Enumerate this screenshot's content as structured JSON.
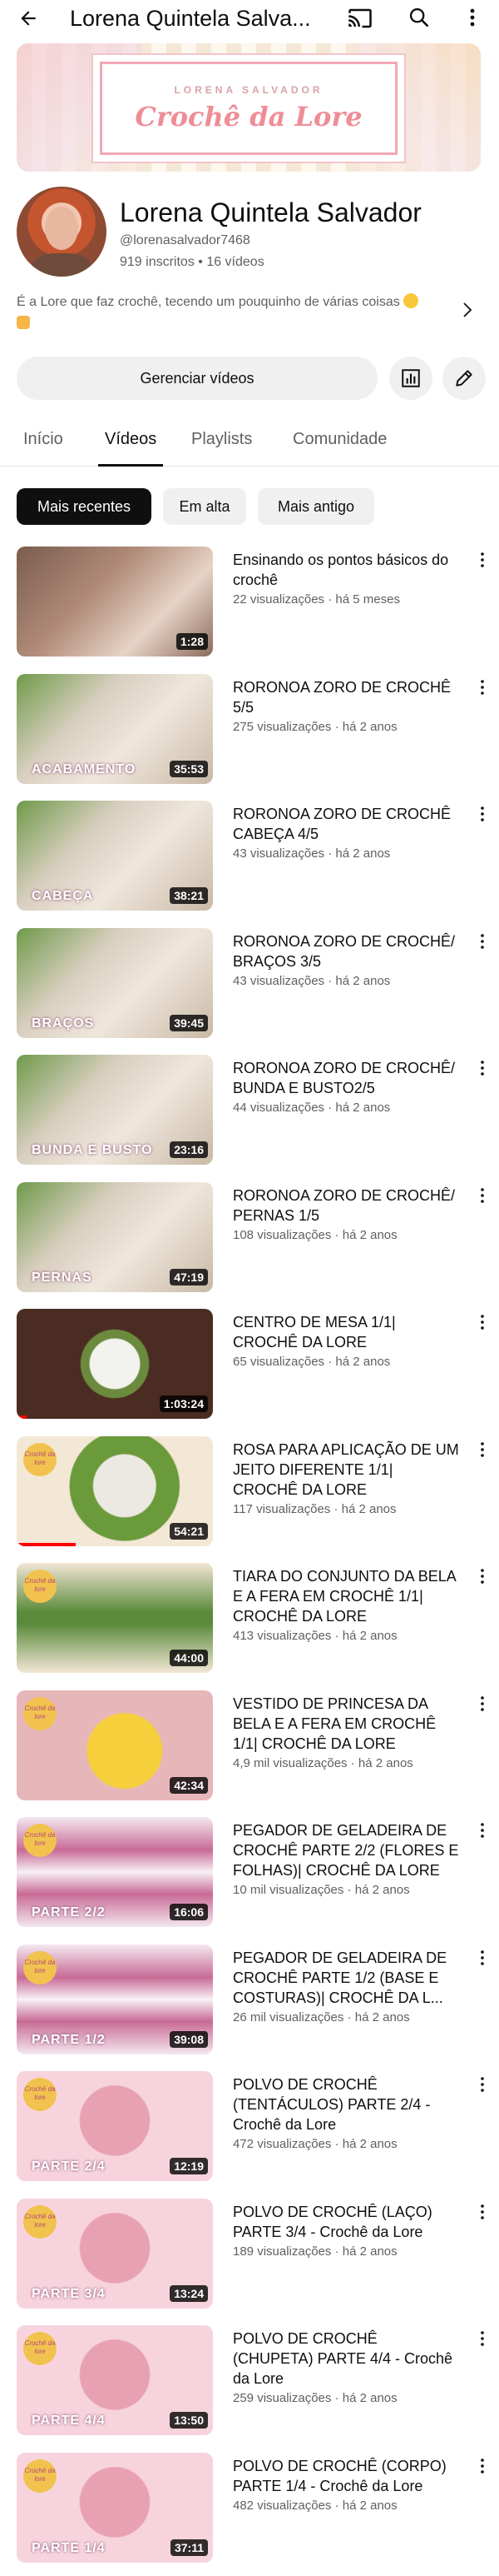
{
  "topbar": {
    "title": "Lorena Quintela Salva..."
  },
  "banner": {
    "subtitle": "LORENA SALVADOR",
    "title": "Crochê da Lore"
  },
  "channel": {
    "name": "Lorena Quintela Salvador",
    "handle": "@lorenasalvador7468",
    "stats": "919 inscritos • 16 vídeos",
    "description": "É a Lore que faz crochê, tecendo um pouquinho de várias coisas"
  },
  "actions": {
    "manage_label": "Gerenciar vídeos"
  },
  "tabs": [
    {
      "label": "Início"
    },
    {
      "label": "Vídeos"
    },
    {
      "label": "Playlists"
    },
    {
      "label": "Comunidade"
    }
  ],
  "chips": [
    {
      "label": "Mais recentes"
    },
    {
      "label": "Em alta"
    },
    {
      "label": "Mais antigo"
    }
  ],
  "colors": {
    "accent": "#ff0000",
    "text_primary": "#0f0f0f",
    "text_secondary": "#606060",
    "chip_bg": "#f0f0f0"
  },
  "videos": [
    {
      "title": "Ensinando os pontos básicos do crochê",
      "views": "22 visualizações",
      "age": "há 5 meses",
      "duration": "1:28",
      "tag": "",
      "logo": "",
      "progress": 0.0
    },
    {
      "title": "RORONOA ZORO DE CROCHÊ 5/5",
      "views": "275 visualizações",
      "age": "há 2 anos",
      "duration": "35:53",
      "tag": "ACABAMENTO",
      "logo": "",
      "progress": 0.0
    },
    {
      "title": "RORONOA ZORO DE CROCHÊ CABEÇA 4/5",
      "views": "43 visualizações",
      "age": "há 2 anos",
      "duration": "38:21",
      "tag": "CABEÇA",
      "logo": "",
      "progress": 0.0
    },
    {
      "title": "RORONOA ZORO DE CROCHÊ/ BRAÇOS 3/5",
      "views": "43 visualizações",
      "age": "há 2 anos",
      "duration": "39:45",
      "tag": "BRAÇOS",
      "logo": "",
      "progress": 0.0
    },
    {
      "title": "RORONOA ZORO DE CROCHÊ/ BUNDA E BUSTO2/5",
      "views": "44 visualizações",
      "age": "há 2 anos",
      "duration": "23:16",
      "tag": "BUNDA E BUSTO",
      "logo": "",
      "progress": 0.0
    },
    {
      "title": "RORONOA ZORO DE CROCHÊ/ PERNAS 1/5",
      "views": "108 visualizações",
      "age": "há 2 anos",
      "duration": "47:19",
      "tag": "PERNAS",
      "logo": "",
      "progress": 0.0
    },
    {
      "title": "CENTRO DE MESA 1/1| CROCHÊ DA LORE",
      "views": "65 visualizações",
      "age": "há 2 anos",
      "duration": "1:03:24",
      "tag": "",
      "logo": "",
      "progress": 0.05
    },
    {
      "title": "ROSA PARA APLICAÇÃO DE UM JEITO DIFERENTE  1/1| CROCHÊ DA LORE",
      "views": "117 visualizações",
      "age": "há 2 anos",
      "duration": "54:21",
      "tag": "",
      "logo": "Crochê da lore",
      "progress": 0.3
    },
    {
      "title": "TIARA DO CONJUNTO DA BELA E A FERA EM CROCHÊ 1/1| CROCHÊ DA LORE",
      "views": "413 visualizações",
      "age": "há 2 anos",
      "duration": "44:00",
      "tag": "",
      "logo": "Crochê da lore",
      "progress": 0.0
    },
    {
      "title": "VESTIDO DE PRINCESA DA BELA E A FERA EM CROCHÊ 1/1| CROCHÊ DA LORE",
      "views": "4,9 mil visualizações",
      "age": "há 2 anos",
      "duration": "42:34",
      "tag": "",
      "logo": "Crochê da lore",
      "progress": 0.0
    },
    {
      "title": "PEGADOR DE GELADEIRA DE CROCHÊ PARTE 2/2 (FLORES E FOLHAS)| CROCHÊ DA LORE",
      "views": "10 mil visualizações",
      "age": "há 2 anos",
      "duration": "16:06",
      "tag": "PARTE 2/2",
      "logo": "Crochê da lore",
      "progress": 0.0
    },
    {
      "title": "PEGADOR DE GELADEIRA DE CROCHÊ PARTE 1/2 (BASE E COSTURAS)| CROCHÊ DA L...",
      "views": "26 mil visualizações",
      "age": "há 2 anos",
      "duration": "39:08",
      "tag": "PARTE 1/2",
      "logo": "Crochê da lore",
      "progress": 0.0
    },
    {
      "title": "POLVO DE CROCHÊ (TENTÁCULOS) PARTE 2/4  - Crochê da Lore",
      "views": "472 visualizações",
      "age": "há 2 anos",
      "duration": "12:19",
      "tag": "PARTE 2/4",
      "logo": "Crochê da lore",
      "progress": 0.0
    },
    {
      "title": "POLVO DE CROCHÊ (LAÇO) PARTE 3/4  - Crochê da Lore",
      "views": "189 visualizações",
      "age": "há 2 anos",
      "duration": "13:24",
      "tag": "PARTE 3/4",
      "logo": "Crochê da lore",
      "progress": 0.0
    },
    {
      "title": "POLVO DE CROCHÊ (CHUPETA) PARTE 4/4  - Crochê da Lore",
      "views": "259 visualizações",
      "age": "há 2 anos",
      "duration": "13:50",
      "tag": "PARTE 4/4",
      "logo": "Crochê da lore",
      "progress": 0.0
    },
    {
      "title": "POLVO DE CROCHÊ (CORPO) PARTE 1/4  - Crochê da Lore",
      "views": "482 visualizações",
      "age": "há 2 anos",
      "duration": "37:11",
      "tag": "PARTE 1/4",
      "logo": "Crochê da lore",
      "progress": 0.0
    }
  ]
}
